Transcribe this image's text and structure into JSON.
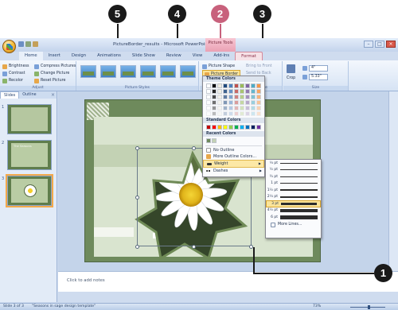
{
  "callouts": {
    "c1": "1",
    "c2": "2",
    "c3": "3",
    "c4": "4",
    "c5": "5"
  },
  "window": {
    "title": "PictureBorder_results - Microsoft PowerPoint",
    "context_tab": "Picture Tools"
  },
  "tabs": [
    "Home",
    "Insert",
    "Design",
    "Animations",
    "Slide Show",
    "Review",
    "View",
    "Add-Ins",
    "Format"
  ],
  "ribbon": {
    "adjust": {
      "brightness": "Brightness",
      "contrast": "Contrast",
      "recolor": "Recolor",
      "compress": "Compress Pictures",
      "change": "Change Picture",
      "reset": "Reset Picture",
      "label": "Adjust"
    },
    "styles_label": "Picture Styles",
    "picture_shape": "Picture Shape",
    "picture_border": "Picture Border",
    "bring_front": "Bring to Front",
    "send_back": "Send to Back",
    "selection_pane": "on Pane",
    "arrange_label": "ange",
    "crop": "Crop",
    "height": "4\"",
    "width": "5.33\"",
    "size_label": "Size"
  },
  "left_pane": {
    "tab_slides": "Slides",
    "tab_outline": "Outline",
    "close": "×",
    "slides": [
      {
        "num": "1",
        "title": ""
      },
      {
        "num": "2",
        "title": "The Seasons"
      },
      {
        "num": "3",
        "title": ""
      }
    ]
  },
  "border_menu": {
    "theme_colors": "Theme Colors",
    "standard_colors": "Standard Colors",
    "recent_colors": "Recent Colors",
    "no_outline": "No Outline",
    "more_colors": "More Outline Colors...",
    "weight": "Weight",
    "dashes": "Dashes",
    "theme_palette": [
      "#ffffff",
      "#000000",
      "#eeece1",
      "#1f497d",
      "#4f81bd",
      "#c0504d",
      "#9bbb59",
      "#8064a2",
      "#4bacc6",
      "#f79646"
    ],
    "standard_palette": [
      "#c00000",
      "#ff0000",
      "#ffc000",
      "#ffff00",
      "#92d050",
      "#00b050",
      "#00b0f0",
      "#0070c0",
      "#002060",
      "#7030a0"
    ],
    "recent_palette": [
      "#6e8a5c",
      "#c3d2b4"
    ]
  },
  "weight_menu": {
    "items": [
      "¼ pt",
      "½ pt",
      "¾ pt",
      "1 pt",
      "1½ pt",
      "2¼ pt",
      "3 pt",
      "4½ pt",
      "6 pt"
    ],
    "selected": "3 pt",
    "more_lines": "More Lines..."
  },
  "notes": {
    "placeholder": "Click to add notes"
  },
  "status": {
    "slide": "Slide 3 of 3",
    "theme": "\"Seasons in sage design template\"",
    "zoom": "73%"
  }
}
